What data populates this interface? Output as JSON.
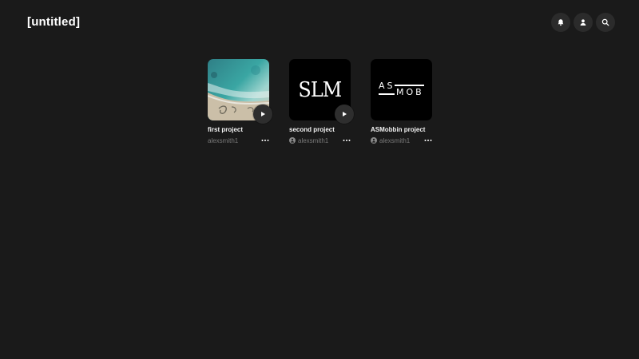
{
  "header": {
    "brand": "[untitled]",
    "actions": [
      {
        "icon": "bell-icon"
      },
      {
        "icon": "user-icon"
      },
      {
        "icon": "search-icon"
      }
    ]
  },
  "projects": [
    {
      "title": "first project",
      "owner": "alexsmith1",
      "thumbnail": "beach-aerial-image",
      "has_play": true,
      "has_avatar": false
    },
    {
      "title": "second project",
      "owner": "alexsmith1",
      "thumbnail": "slm-wordmark",
      "wordmark": "SLM",
      "has_play": true,
      "has_avatar": true
    },
    {
      "title": "ASMobbin project",
      "owner": "alexsmith1",
      "thumbnail": "asmob-wordmark",
      "wordmark_a": "AS",
      "wordmark_b": "MOB",
      "has_play": false,
      "has_avatar": true
    }
  ],
  "colors": {
    "background": "#1a1a1a",
    "button": "#2b2b2b",
    "muted_text": "#7a7a7a"
  }
}
